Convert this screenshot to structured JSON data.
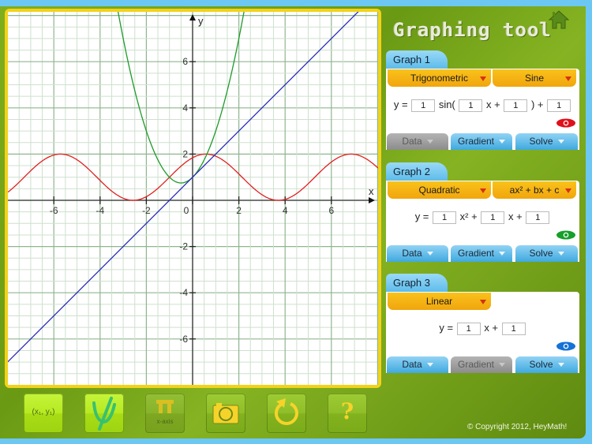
{
  "app": {
    "title": "Graphing tool",
    "copyright": "© Copyright 2012, HeyMath!"
  },
  "graph_panel": {
    "x_axis_label": "x",
    "y_axis_label": "y",
    "x_ticks": [
      "-6",
      "-4",
      "-2",
      "0",
      "2",
      "4",
      "6"
    ],
    "y_ticks": [
      "6",
      "4",
      "2",
      "-2",
      "-4",
      "-6"
    ],
    "x_range": [
      -8,
      8
    ],
    "y_range": [
      -8,
      8.1
    ],
    "curves": [
      {
        "name": "Graph 1",
        "function": "1*sin(1*x+1)+1",
        "color": "#e02020"
      },
      {
        "name": "Graph 2",
        "function": "1*x^2+1*x+1",
        "color": "#1f9a2a"
      },
      {
        "name": "Graph 3",
        "function": "1*x+1",
        "color": "#2a2ab8"
      }
    ]
  },
  "graphs": [
    {
      "tab": "Graph 1",
      "type": "Trigonometric",
      "subtype": "Sine",
      "equation": {
        "prefix": "y =",
        "a": "1",
        "t1": "sin(",
        "b": "1",
        "t2": "x +",
        "c": "1",
        "t3": ") +",
        "d": "1"
      },
      "eye_color": "#e0101a",
      "buttons": [
        {
          "label": "Data",
          "enabled": false
        },
        {
          "label": "Gradient",
          "enabled": true
        },
        {
          "label": "Solve",
          "enabled": true
        }
      ]
    },
    {
      "tab": "Graph 2",
      "type": "Quadratic",
      "subtype": "ax² + bx + c",
      "equation": {
        "prefix": "y =",
        "a": "1",
        "t1": "x² +",
        "b": "1",
        "t2": "x +",
        "c": "1"
      },
      "eye_color": "#15a02a",
      "buttons": [
        {
          "label": "Data",
          "enabled": true
        },
        {
          "label": "Gradient",
          "enabled": true
        },
        {
          "label": "Solve",
          "enabled": true
        }
      ]
    },
    {
      "tab": "Graph 3",
      "type": "Linear",
      "equation": {
        "prefix": "y =",
        "a": "1",
        "t1": "x +",
        "b": "1"
      },
      "eye_color": "#1572d6",
      "buttons": [
        {
          "label": "Data",
          "enabled": true
        },
        {
          "label": "Gradient",
          "enabled": false
        },
        {
          "label": "Solve",
          "enabled": true
        }
      ]
    }
  ],
  "toolbar": {
    "point_label": "(x₁, y₁)",
    "pi_label": "x-axis",
    "help_glyph": "?"
  }
}
